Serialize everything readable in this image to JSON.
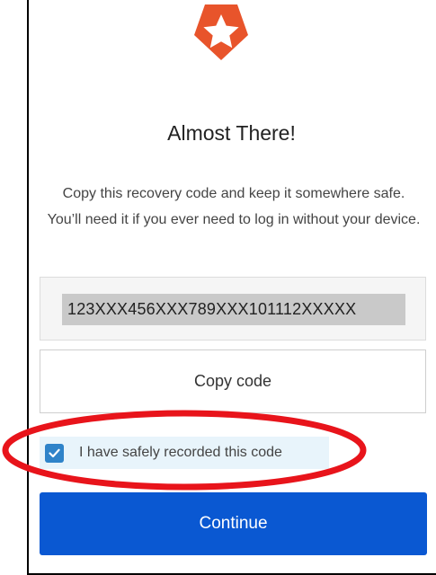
{
  "logo": {
    "icon": "star-shield-icon",
    "color": "#e8542b"
  },
  "title": "Almost There!",
  "instructions": "Copy this recovery code and keep it somewhere safe. You’ll need it if you ever need to log in without your device.",
  "recovery_code": "123XXX456XXX789XXX101112XXXXX",
  "copy_button_label": "Copy code",
  "confirm": {
    "label": "I have safely recorded this code",
    "checked": true,
    "checkbox_color": "#2f83c9"
  },
  "continue_button_label": "Continue",
  "colors": {
    "accent": "#0a58d2",
    "highlight": "#e8141b"
  }
}
